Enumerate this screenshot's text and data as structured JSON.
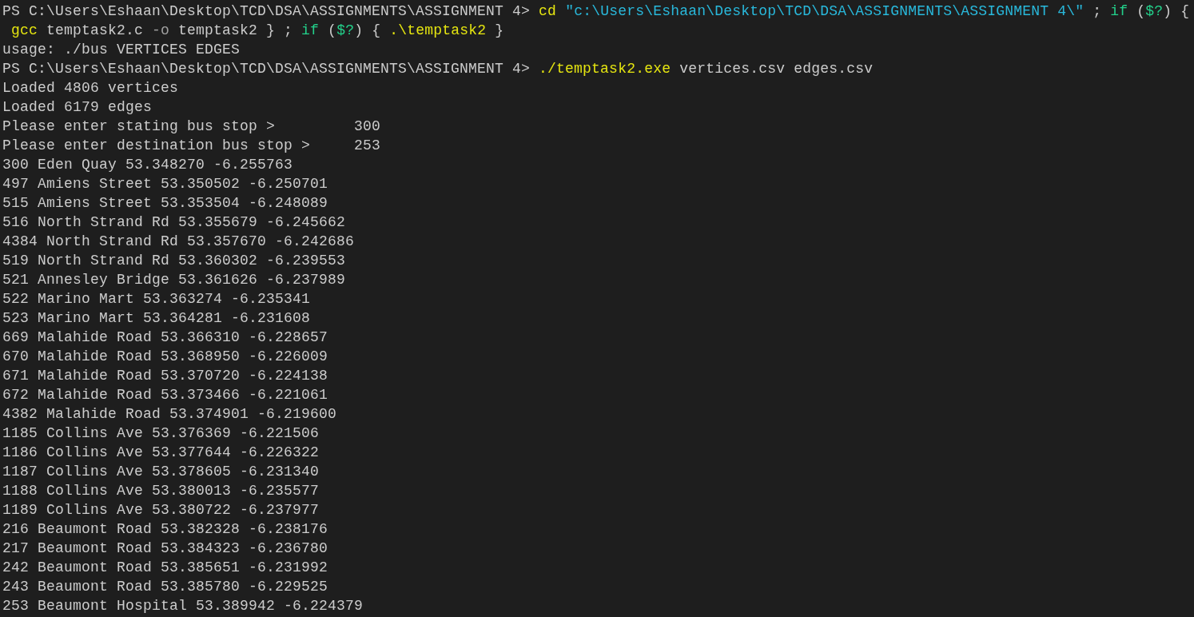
{
  "terminal": {
    "lines": [
      [
        {
          "kind": "plain",
          "text": "PS C:\\Users\\Eshaan\\Desktop\\TCD\\DSA\\ASSIGNMENTS\\ASSIGNMENT 4> "
        },
        {
          "kind": "command",
          "text": "cd"
        },
        {
          "kind": "string",
          "text": " \"c:\\Users\\Eshaan\\Desktop\\TCD\\DSA\\ASSIGNMENTS\\ASSIGNMENT 4\\\""
        },
        {
          "kind": "plain",
          "text": " ; "
        },
        {
          "kind": "keyword",
          "text": "if"
        },
        {
          "kind": "plain",
          "text": " ("
        },
        {
          "kind": "keyword",
          "text": "$?"
        },
        {
          "kind": "plain",
          "text": ") {"
        }
      ],
      [
        {
          "kind": "command",
          "text": " gcc"
        },
        {
          "kind": "plain",
          "text": " temptask2.c "
        },
        {
          "kind": "parameter",
          "text": "-o"
        },
        {
          "kind": "plain",
          "text": " temptask2 } ; "
        },
        {
          "kind": "keyword",
          "text": "if"
        },
        {
          "kind": "plain",
          "text": " ("
        },
        {
          "kind": "keyword",
          "text": "$?"
        },
        {
          "kind": "plain",
          "text": ") { "
        },
        {
          "kind": "command",
          "text": ".\\temptask2"
        },
        {
          "kind": "plain",
          "text": " }"
        }
      ],
      [
        {
          "kind": "plain",
          "text": "usage: ./bus VERTICES EDGES"
        }
      ],
      [
        {
          "kind": "plain",
          "text": "PS C:\\Users\\Eshaan\\Desktop\\TCD\\DSA\\ASSIGNMENTS\\ASSIGNMENT 4> "
        },
        {
          "kind": "command",
          "text": "./temptask2.exe"
        },
        {
          "kind": "plain",
          "text": " vertices.csv edges.csv"
        }
      ],
      [
        {
          "kind": "plain",
          "text": "Loaded 4806 vertices"
        }
      ],
      [
        {
          "kind": "plain",
          "text": "Loaded 6179 edges"
        }
      ],
      [
        {
          "kind": "plain",
          "text": "Please enter stating bus stop >         300"
        }
      ],
      [
        {
          "kind": "plain",
          "text": "Please enter destination bus stop >     253"
        }
      ],
      [
        {
          "kind": "plain",
          "text": "300 Eden Quay 53.348270 -6.255763"
        }
      ],
      [
        {
          "kind": "plain",
          "text": "497 Amiens Street 53.350502 -6.250701"
        }
      ],
      [
        {
          "kind": "plain",
          "text": "515 Amiens Street 53.353504 -6.248089"
        }
      ],
      [
        {
          "kind": "plain",
          "text": "516 North Strand Rd 53.355679 -6.245662"
        }
      ],
      [
        {
          "kind": "plain",
          "text": "4384 North Strand Rd 53.357670 -6.242686"
        }
      ],
      [
        {
          "kind": "plain",
          "text": "519 North Strand Rd 53.360302 -6.239553"
        }
      ],
      [
        {
          "kind": "plain",
          "text": "521 Annesley Bridge 53.361626 -6.237989"
        }
      ],
      [
        {
          "kind": "plain",
          "text": "522 Marino Mart 53.363274 -6.235341"
        }
      ],
      [
        {
          "kind": "plain",
          "text": "523 Marino Mart 53.364281 -6.231608"
        }
      ],
      [
        {
          "kind": "plain",
          "text": "669 Malahide Road 53.366310 -6.228657"
        }
      ],
      [
        {
          "kind": "plain",
          "text": "670 Malahide Road 53.368950 -6.226009"
        }
      ],
      [
        {
          "kind": "plain",
          "text": "671 Malahide Road 53.370720 -6.224138"
        }
      ],
      [
        {
          "kind": "plain",
          "text": "672 Malahide Road 53.373466 -6.221061"
        }
      ],
      [
        {
          "kind": "plain",
          "text": "4382 Malahide Road 53.374901 -6.219600"
        }
      ],
      [
        {
          "kind": "plain",
          "text": "1185 Collins Ave 53.376369 -6.221506"
        }
      ],
      [
        {
          "kind": "plain",
          "text": "1186 Collins Ave 53.377644 -6.226322"
        }
      ],
      [
        {
          "kind": "plain",
          "text": "1187 Collins Ave 53.378605 -6.231340"
        }
      ],
      [
        {
          "kind": "plain",
          "text": "1188 Collins Ave 53.380013 -6.235577"
        }
      ],
      [
        {
          "kind": "plain",
          "text": "1189 Collins Ave 53.380722 -6.237977"
        }
      ],
      [
        {
          "kind": "plain",
          "text": "216 Beaumont Road 53.382328 -6.238176"
        }
      ],
      [
        {
          "kind": "plain",
          "text": "217 Beaumont Road 53.384323 -6.236780"
        }
      ],
      [
        {
          "kind": "plain",
          "text": "242 Beaumont Road 53.385651 -6.231992"
        }
      ],
      [
        {
          "kind": "plain",
          "text": "243 Beaumont Road 53.385780 -6.229525"
        }
      ],
      [
        {
          "kind": "plain",
          "text": "253 Beaumont Hospital 53.389942 -6.224379"
        }
      ]
    ]
  }
}
